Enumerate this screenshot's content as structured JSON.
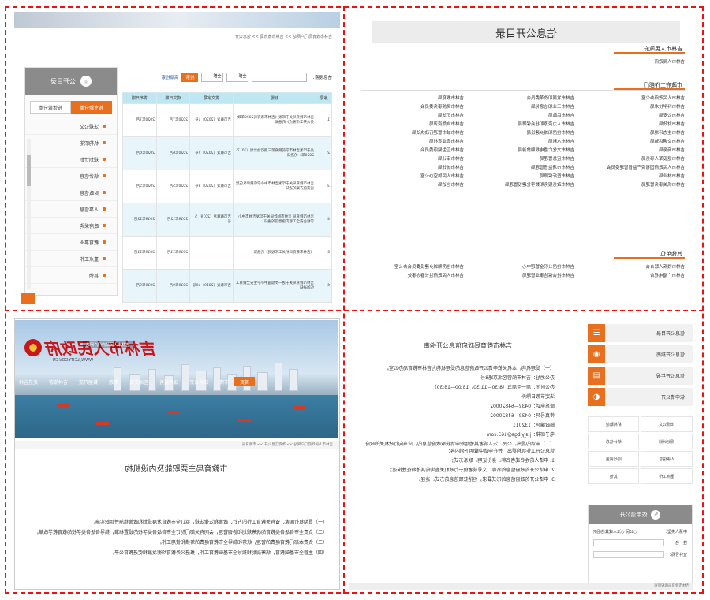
{
  "directory": {
    "title": "信息公开目录",
    "sec1_head": "吉林市人民政府",
    "sec1_items": [
      "吉林市人民政府"
    ],
    "sec2_head": "市政府工作部门",
    "sec2_items": [
      "吉林市人民政府办公室",
      "吉林市发展和改革委员会",
      "吉林市教育局",
      "吉林市科学技术局",
      "吉林市工业和信息化局",
      "吉林市民族事务委员会",
      "吉林市公安局",
      "吉林市民政局",
      "吉林市司法局",
      "吉林市财政局",
      "吉林市人力资源和社会保障局",
      "吉林市自然资源局",
      "吉林市生态环境局",
      "吉林市住房和城乡建设局",
      "吉林市城市管理行政执法局",
      "吉林市交通运输局",
      "吉林市水利局",
      "吉林市农业农村局",
      "吉林市商务局",
      "吉林市文化广播电视和旅游局",
      "吉林市卫生健康委员会",
      "吉林市退役军人事务局",
      "吉林市应急管理局",
      "吉林市审计局",
      "吉林市人民政府国有资产监督管理委员会",
      "吉林市市场监督管理局",
      "吉林市统计局",
      "吉林市林业局",
      "吉林市医疗保障局",
      "吉林市人民防空办公室",
      "吉林市机关事务管理局",
      "吉林市政务服务和数字化建设管理局",
      "吉林市信访局"
    ],
    "sec3_head": "其他单位",
    "sec3_items": [
      "吉林市残疾人联合会",
      "吉林市住房公积金管理中心",
      "吉林市住房和城乡建设委员会办公室",
      "吉林市广播电视台",
      "吉林市社会保险事业管理局",
      "吉林市人民政府驻长春办事处"
    ]
  },
  "table_page": {
    "breadcrumb": "吉林市教育局门户网站 >> 吉林市教育局 >> 信息公开",
    "search_label": "信息搜索：",
    "search_value": "",
    "select1": "全部",
    "select2": "全部",
    "search_button": "检索",
    "advanced_link": "高级检索",
    "columns": [
      "序号",
      "标题",
      "发文字号",
      "成文日期",
      "发布日期"
    ],
    "rows": [
      [
        "1",
        "吉林市教育局关于印发《吉林市教育局2020年政务公开工作要点》的通知",
        "吉市教发〔2020〕1号",
        "2020年7月",
        "2020年7月"
      ],
      [
        "2",
        "关于印发吉林市学前教育第三期行动计划（2017-2020年）的通知",
        "吉市教发〔2020〕2号",
        "2020年6月",
        "2020年6月"
      ],
      [
        "3",
        "吉林市教育局关于印发吉林市中小学校教师队伍建设实施方案的通知",
        "吉市教发〔2020〕3号",
        "2020年5月",
        "2020年5月"
      ],
      [
        "4",
        "吉林市教育局 吉林市财政局关于印发吉林市中小学校舍安全工程实施意见的通知",
        "吉市教联发〔2019〕5号",
        "2019年12月",
        "2019年12月"
      ],
      [
        "5",
        "《吉林市教育局机关工作规则》的通知",
        "",
        "2019年11月",
        "2019年11月"
      ],
      [
        "6",
        "吉林市教育局关于进一步加强中小学生安全教育工作的通知",
        "吉市教发〔2019〕10号",
        "2019年9月",
        "2019年9月"
      ]
    ],
    "side_title": "公开目录",
    "side_tabs": [
      "按主题分类",
      "按体裁分类"
    ],
    "side_items": [
      "法规公文",
      "机构职能",
      "规划计划",
      "统计信息",
      "财政信息",
      "人事信息",
      "政府采购",
      "教育事业",
      "重点工作",
      "其他"
    ]
  },
  "portal": {
    "logo_text": "吉林市人民政府",
    "site_url": "WWW.JLCITY.GOV.CN",
    "top_note": "吉林市人民政府门户网站",
    "nav": [
      "首页",
      "市情",
      "政务公开",
      "政务服务",
      "互动交流",
      "专题",
      "数据开放",
      "吉林旅游",
      "走进吉林"
    ],
    "breadcrumb": "吉林市人民政府门户网站 >> 政府信息公开 >> 市教育局",
    "article_title": "市教育局主要职能及内设机构",
    "paragraphs": [
      "（一）贯彻执行国家、省有关教育工作的方针、政策和法律法规，拟订全市教育发展规划和政策措施并组织实施。",
      "（二）负责全市各级各类教育的统筹规划和协调管理，会同有关部门制订全市各级各类学校的设置标准，指导各级各类学校的教育教学改革。",
      "（三）负责本部门教育经费的管理，统筹和指导全市教育经费的筹措和使用工作。",
      "（四）主管全市基础教育，统筹规划和指导全市基础教育工作，推进义务教育均衡发展和促进教育公平。"
    ]
  },
  "guide": {
    "quick_links": [
      {
        "label": "信息公开目录",
        "icon": "list-icon"
      },
      {
        "label": "信息公开指南",
        "icon": "guide-icon"
      },
      {
        "label": "信息公开年报",
        "icon": "report-icon"
      },
      {
        "label": "依申请公开",
        "icon": "apply-icon"
      }
    ],
    "mini_links": [
      "法规公文",
      "机构职能",
      "规划计划",
      "统计信息",
      "人事信息",
      "财政资金",
      "重点工作",
      "其他"
    ],
    "apply_title": "依申请公开",
    "apply_fields": [
      "申请人类型：",
      "姓　名：",
      "证件号码："
    ],
    "apply_type_value": "○公民  ○法人或其他组织",
    "title": "吉林市教育局政府信息公开指南",
    "paragraphs": [
      "（一）受理机构。本机关依申请公开政府信息的受理机构为吉林市教育局办公室。",
      "办公地址：吉林市船营区北京路8号",
      "办公时间：周一至周五（8:30—11:30，13:00—16:30）",
      "法定节假日除外",
      "联系电话：0432—64820002",
      "传真号码：0432—64820002",
      "邮政编码：132011",
      "电子邮箱：jlsjyjbgs@163.com",
      "（二）申请的提出。公民、法人或者其他组织申请获取政府信息的，应当向行政机关的政府信息公开工作机构提出，并在申请中载明下列内容：",
      "1. 申请人的姓名或者名称、身份证明、联系方式；",
      "2. 申请公开的政府信息的名称、文号或者便于行政机关查询的其他特征性描述；",
      "3. 申请公开的政府信息的形式要求，包括获取信息的方式、途径。"
    ],
    "footer": "吉林市教育局版权所有"
  }
}
